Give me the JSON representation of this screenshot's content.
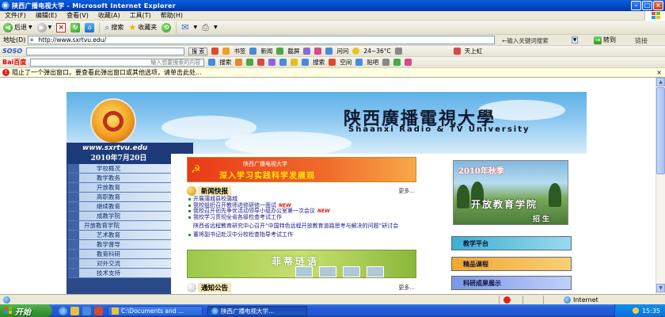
{
  "window": {
    "title": "陕西广播电视大学 - Microsoft Internet Explorer"
  },
  "menu": [
    "文件(F)",
    "编辑(E)",
    "查看(V)",
    "收藏(A)",
    "工具(T)",
    "帮助(H)"
  ],
  "toolbar": {
    "back": "后退",
    "search": "搜索",
    "favorites": "收藏夹"
  },
  "address": {
    "label": "地址(D)",
    "url": "http://www.sxrtvu.edu/",
    "search_hint": "←输入关键词搜索",
    "go": "转到",
    "links": "链接"
  },
  "soso": {
    "brand": "SOSO",
    "search_btn": "搜 索",
    "bookmark": "书签",
    "news": "新闻",
    "screenshot": "截屏",
    "qa": "问问",
    "weather": "24~36°C",
    "sky": "天上虹"
  },
  "baidu": {
    "brand": "Bai百度",
    "placeholder": "输入想要搜索的内容",
    "search": "搜索",
    "space": "空间",
    "post": "贴吧"
  },
  "popup": {
    "message": "阻止了一个弹出窗口。要查看此弹出窗口或其他选项，请单击此处..."
  },
  "site": {
    "cn_name": "陕西廣播電視大學",
    "en_name": "Shaanxi Radio & TV University",
    "url": "www.sxrtvu.edu",
    "date": "2010年7月20日",
    "nav": [
      "学校概况",
      "教学教务",
      "开放教育",
      "高职教育",
      "继续教育",
      "成教学院",
      "开放教育学院",
      "艺术教育",
      "教学督导",
      "教育科研",
      "对外交流",
      "技术支持"
    ],
    "red_banner_top": "陕西广播电视大学",
    "red_banner": "深入学习实践科学发展观",
    "news_title": "新闻快报",
    "more": "更多...",
    "news": [
      {
        "text": "开展蒲城县校蒲城",
        "is_new": false
      },
      {
        "text": "我校组织召开教师进修研修一面试",
        "is_new": true
      },
      {
        "text": "我校召开创先争优活动领导小组办公室第一次会议",
        "is_new": true
      },
      {
        "text": "我校学习贯彻全省各级检查考试工作",
        "is_new": false
      },
      {
        "text": "陕西省远程教育研究中心召开“中国特色远程开放教育道路思考与解决的问题”研讨会",
        "is_new": false
      },
      {
        "text": "董将副书记赴汉中分校检查指导考试工作",
        "is_new": false
      }
    ],
    "green_banner": "菲蒂琏语",
    "notice_title": "通知公告",
    "notice_more": "更多...",
    "photo_top": "2010年秋季",
    "photo_mid": "开放教育学院",
    "photo_bottom": "招生",
    "right_buttons": [
      "教学平台",
      "精品课程",
      "科研成果展示"
    ]
  },
  "status": {
    "zone": "Internet"
  },
  "taskbar": {
    "start": "开始",
    "tasks": [
      "C:\\Documents and ...",
      "陕西广播电视大学..."
    ],
    "clock": "15:35"
  },
  "colors": {
    "title_blue": "#0047c8",
    "nav_blue": "#2a4a8a",
    "start_green": "#3a9a3a"
  }
}
